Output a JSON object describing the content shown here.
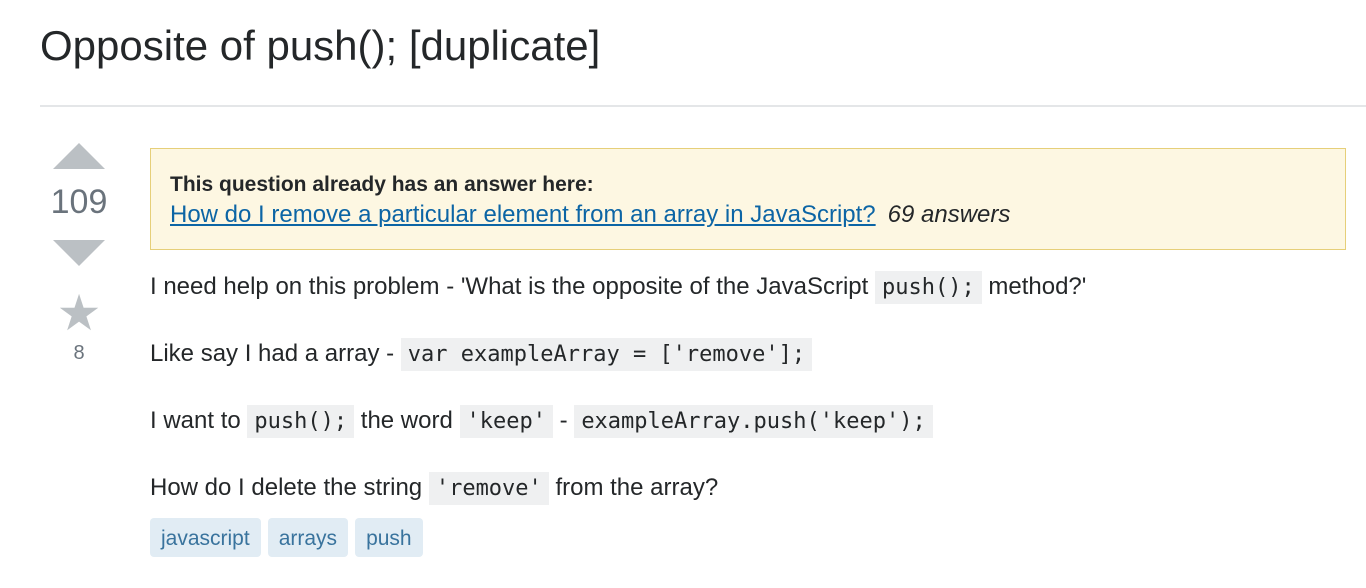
{
  "question": {
    "title": "Opposite of push(); [duplicate]"
  },
  "votes": {
    "score": "109",
    "favorites": "8"
  },
  "duplicate_notice": {
    "heading": "This question already has an answer here:",
    "link_text": "How do I remove a particular element from an array in JavaScript?",
    "answer_count": "69 answers"
  },
  "body": {
    "p1_text_a": "I need help on this problem - 'What is the opposite of the JavaScript ",
    "p1_code": "push();",
    "p1_text_b": " method?'",
    "p2_text_a": "Like say I had a array - ",
    "p2_code": "var exampleArray = ['remove'];",
    "p3_text_a": "I want to ",
    "p3_code_a": "push();",
    "p3_text_b": " the word ",
    "p3_code_b": "'keep'",
    "p3_text_c": " - ",
    "p3_code_c": "exampleArray.push('keep');",
    "p4_text_a": "How do I delete the string ",
    "p4_code": "'remove'",
    "p4_text_b": " from the array?"
  },
  "tags": [
    "javascript",
    "arrays",
    "push"
  ],
  "icons": {
    "upvote": "arrow-up-icon",
    "downvote": "arrow-down-icon",
    "favorite": "star-icon"
  },
  "colors": {
    "link": "#0c65a5",
    "tag_bg": "#e1ecf4",
    "tag_text": "#39739d",
    "notice_bg": "#fdf7e2",
    "notice_border": "#e6cf79"
  }
}
